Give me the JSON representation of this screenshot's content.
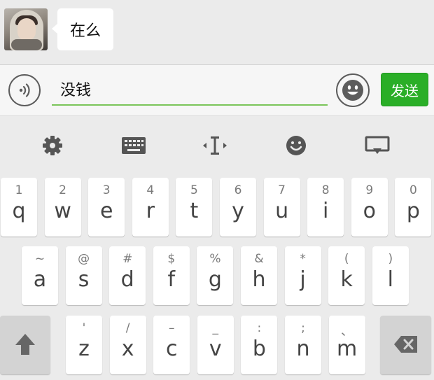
{
  "chat": {
    "message": "在么"
  },
  "input": {
    "value": "没钱",
    "send_label": "发送"
  },
  "toolbar": {
    "icons": [
      "gear-icon",
      "keyboard-icon",
      "cursor-icon",
      "emoji-icon",
      "hide-keyboard-icon"
    ]
  },
  "keyboard": {
    "row1": [
      {
        "main": "q",
        "hint": "1"
      },
      {
        "main": "w",
        "hint": "2"
      },
      {
        "main": "e",
        "hint": "3"
      },
      {
        "main": "r",
        "hint": "4"
      },
      {
        "main": "t",
        "hint": "5"
      },
      {
        "main": "y",
        "hint": "6"
      },
      {
        "main": "u",
        "hint": "7"
      },
      {
        "main": "i",
        "hint": "8"
      },
      {
        "main": "o",
        "hint": "9"
      },
      {
        "main": "p",
        "hint": "0"
      }
    ],
    "row2": [
      {
        "main": "a",
        "hint": "~"
      },
      {
        "main": "s",
        "hint": "@"
      },
      {
        "main": "d",
        "hint": "#"
      },
      {
        "main": "f",
        "hint": "$"
      },
      {
        "main": "g",
        "hint": "%"
      },
      {
        "main": "h",
        "hint": "&"
      },
      {
        "main": "j",
        "hint": "*"
      },
      {
        "main": "k",
        "hint": "("
      },
      {
        "main": "l",
        "hint": ")"
      }
    ],
    "row3": [
      {
        "main": "z",
        "hint": "'"
      },
      {
        "main": "x",
        "hint": "/"
      },
      {
        "main": "c",
        "hint": "–"
      },
      {
        "main": "v",
        "hint": "_"
      },
      {
        "main": "b",
        "hint": ":"
      },
      {
        "main": "n",
        "hint": ";"
      },
      {
        "main": "m",
        "hint": "、"
      }
    ]
  },
  "colors": {
    "send_green": "#2aae27",
    "input_underline": "#7ac55a",
    "background": "#ebebeb"
  }
}
